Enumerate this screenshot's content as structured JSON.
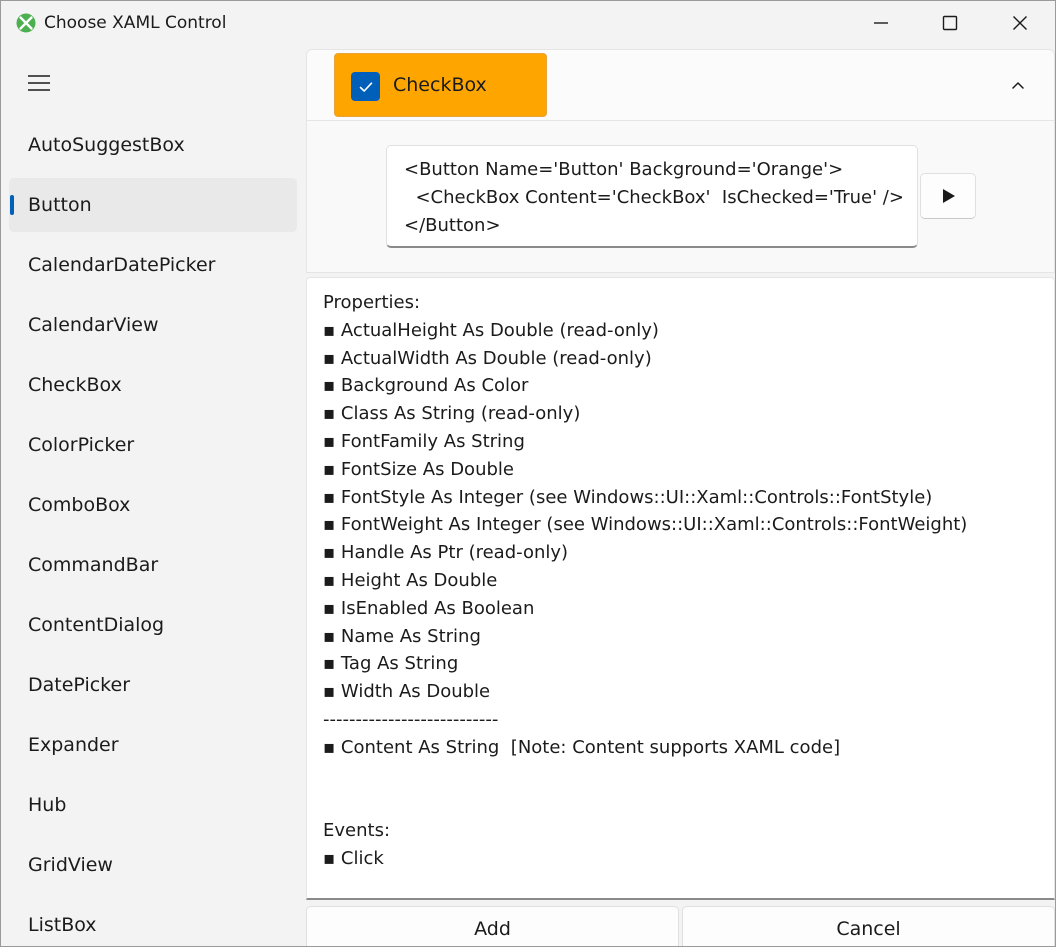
{
  "window": {
    "title": "Choose XAML Control"
  },
  "sidebar": {
    "items": [
      {
        "label": "AutoSuggestBox",
        "selected": false
      },
      {
        "label": "Button",
        "selected": true
      },
      {
        "label": "CalendarDatePicker",
        "selected": false
      },
      {
        "label": "CalendarView",
        "selected": false
      },
      {
        "label": "CheckBox",
        "selected": false
      },
      {
        "label": "ColorPicker",
        "selected": false
      },
      {
        "label": "ComboBox",
        "selected": false
      },
      {
        "label": "CommandBar",
        "selected": false
      },
      {
        "label": "ContentDialog",
        "selected": false
      },
      {
        "label": "DatePicker",
        "selected": false
      },
      {
        "label": "Expander",
        "selected": false
      },
      {
        "label": "Hub",
        "selected": false
      },
      {
        "label": "GridView",
        "selected": false
      },
      {
        "label": "ListBox",
        "selected": false
      }
    ]
  },
  "preview": {
    "checkbox_label": "CheckBox",
    "checkbox_checked": true,
    "button_background": "#FFA500"
  },
  "code": {
    "text": "<Button Name='Button' Background='Orange'>\n  <CheckBox Content='CheckBox'  IsChecked='True' />\n</Button>"
  },
  "properties": {
    "lines": [
      "Properties:",
      "▪ ActualHeight As Double (read-only)",
      "▪ ActualWidth As Double (read-only)",
      "▪ Background As Color",
      "▪ Class As String (read-only)",
      "▪ FontFamily As String",
      "▪ FontSize As Double",
      "▪ FontStyle As Integer (see Windows::UI::Xaml::Controls::FontStyle)",
      "▪ FontWeight As Integer (see Windows::UI::Xaml::Controls::FontWeight)",
      "▪ Handle As Ptr (read-only)",
      "▪ Height As Double",
      "▪ IsEnabled As Boolean",
      "▪ Name As String",
      "▪ Tag As String",
      "▪ Width As Double",
      "---------------------------",
      "▪ Content As String  [Note: Content supports XAML code]",
      "",
      "",
      "Events:",
      "▪ Click"
    ]
  },
  "actions": {
    "add_label": "Add",
    "cancel_label": "Cancel"
  },
  "colors": {
    "accent": "#005FB8",
    "preview_background": "#FFA500"
  }
}
